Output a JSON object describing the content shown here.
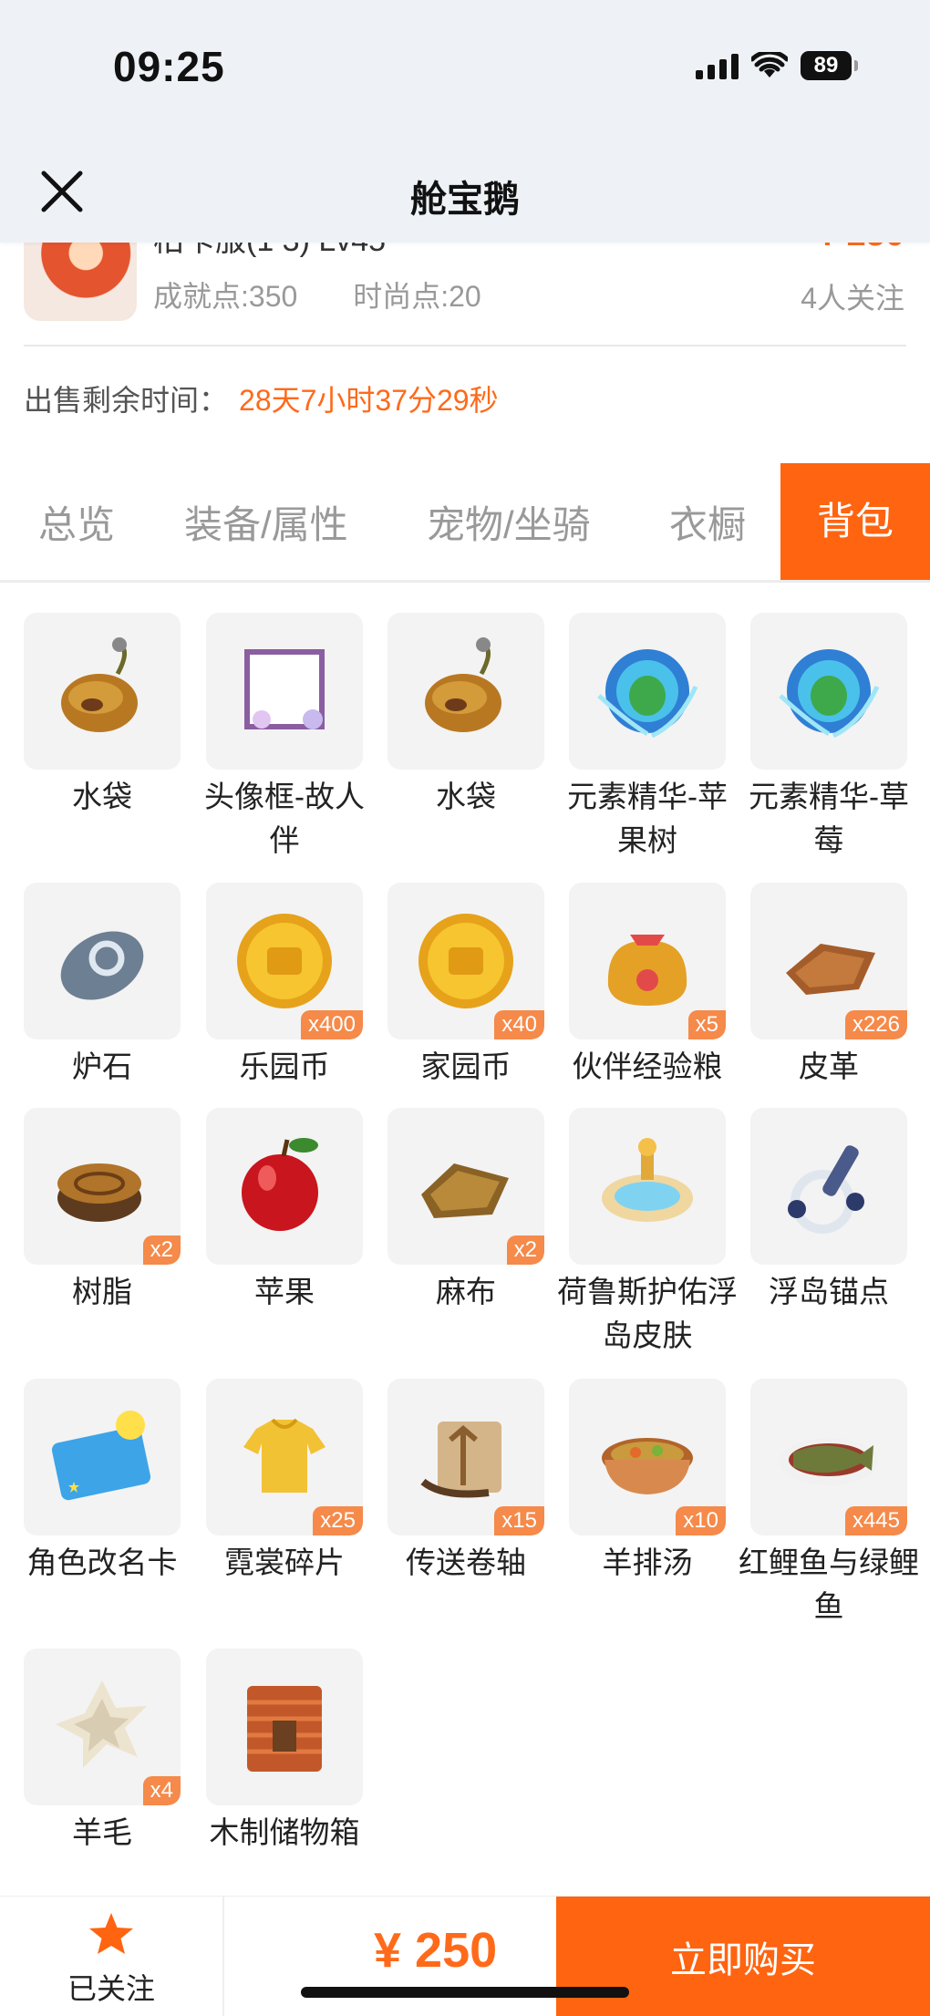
{
  "status_bar": {
    "time": "09:25",
    "battery": "89"
  },
  "nav": {
    "title": "舱宝鹅"
  },
  "product": {
    "name_partial": "柏卡服(1 3)  Lv45",
    "price_partial": "¥ 250",
    "achievement": "成就点:350",
    "fashion": "时尚点:20",
    "followers": "4人关注"
  },
  "countdown": {
    "label": "出售剩余时间：",
    "value": "28天7小时37分29秒"
  },
  "tabs": [
    {
      "label": "总览"
    },
    {
      "label": "装备/属性"
    },
    {
      "label": "宠物/坐骑"
    },
    {
      "label": "衣橱"
    },
    {
      "label": "背包",
      "active": true
    }
  ],
  "items": [
    {
      "name": "水袋",
      "icon": "water-bag",
      "qty": ""
    },
    {
      "name": "头像框-故人伴",
      "icon": "avatar-frame",
      "qty": ""
    },
    {
      "name": "水袋",
      "icon": "water-bag",
      "qty": ""
    },
    {
      "name": "元素精华-苹果树",
      "icon": "element-orb",
      "qty": ""
    },
    {
      "name": "元素精华-草莓",
      "icon": "element-orb",
      "qty": ""
    },
    {
      "name": "炉石",
      "icon": "hearthstone",
      "qty": ""
    },
    {
      "name": "乐园币",
      "icon": "gold-coin",
      "qty": "x400"
    },
    {
      "name": "家园币",
      "icon": "gold-coin",
      "qty": "x40"
    },
    {
      "name": "伙伴经验粮",
      "icon": "food-bag",
      "qty": "x5"
    },
    {
      "name": "皮革",
      "icon": "leather",
      "qty": "x226"
    },
    {
      "name": "树脂",
      "icon": "resin-stump",
      "qty": "x2"
    },
    {
      "name": "苹果",
      "icon": "apple",
      "qty": ""
    },
    {
      "name": "麻布",
      "icon": "linen",
      "qty": "x2"
    },
    {
      "name": "荷鲁斯护佑浮岛皮肤",
      "icon": "island-skin",
      "qty": ""
    },
    {
      "name": "浮岛锚点",
      "icon": "anchor",
      "qty": ""
    },
    {
      "name": "角色改名卡",
      "icon": "rename-card",
      "qty": ""
    },
    {
      "name": "霓裳碎片",
      "icon": "shirt-shard",
      "qty": "x25"
    },
    {
      "name": "传送卷轴",
      "icon": "scroll",
      "qty": "x15"
    },
    {
      "name": "羊排汤",
      "icon": "soup",
      "qty": "x10"
    },
    {
      "name": "红鲤鱼与绿鲤鱼",
      "icon": "fish-dish",
      "qty": "x445"
    },
    {
      "name": "羊毛",
      "icon": "wool",
      "qty": "x4"
    },
    {
      "name": "木制储物箱",
      "icon": "wood-crate",
      "qty": ""
    }
  ],
  "bottom": {
    "follow_label": "已关注",
    "price": "¥ 250",
    "buy_label": "立即购买"
  },
  "colors": {
    "accent": "#ff6410",
    "price": "#ff6a1a",
    "qty_badge": "#f58a4a"
  }
}
